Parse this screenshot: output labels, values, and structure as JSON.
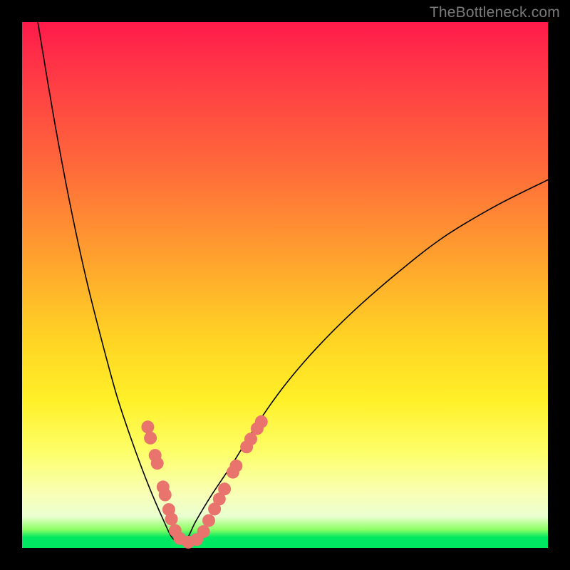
{
  "watermark": "TheBottleneck.com",
  "chart_data": {
    "type": "line",
    "title": "",
    "xlabel": "",
    "ylabel": "",
    "xlim": [
      0,
      100
    ],
    "ylim": [
      0,
      100
    ],
    "grid": false,
    "legend": false,
    "background_gradient": {
      "direction": "vertical",
      "note": "y_pct is distance from TOP of plot (0=top, 100=bottom); color encodes bottleneck severity, green=optimal",
      "stops": [
        {
          "y_pct": 0,
          "color": "#ff1a4a"
        },
        {
          "y_pct": 28,
          "color": "#ff6b3a"
        },
        {
          "y_pct": 60,
          "color": "#ffd324"
        },
        {
          "y_pct": 82,
          "color": "#fdff6b"
        },
        {
          "y_pct": 94,
          "color": "#eaffd0"
        },
        {
          "y_pct": 98,
          "color": "#00e861"
        }
      ]
    },
    "series": [
      {
        "name": "bottleneck-curve",
        "note": "V-shaped curve; x in arbitrary 0-100 units across plot width, y is percent from TOP (0=top edge). Minimum (~y=99) near x≈30.",
        "x": [
          3,
          6,
          9,
          12,
          15,
          18,
          21,
          24,
          27,
          28.5,
          30,
          31.5,
          33,
          36,
          40,
          45,
          50,
          56,
          63,
          71,
          80,
          90,
          100
        ],
        "y": [
          0,
          18,
          34,
          48,
          60,
          71,
          80,
          88,
          95,
          98,
          99,
          98,
          95,
          90,
          84,
          76,
          69,
          62,
          55,
          48,
          41,
          35,
          30
        ]
      }
    ],
    "markers": {
      "name": "highlighted-points",
      "note": "Pink dot clusters near the cusp on both branches (plot-fraction coords, 0-1 from top-left).",
      "points": [
        {
          "x": 0.239,
          "y": 0.77
        },
        {
          "x": 0.244,
          "y": 0.791
        },
        {
          "x": 0.253,
          "y": 0.824
        },
        {
          "x": 0.257,
          "y": 0.839
        },
        {
          "x": 0.268,
          "y": 0.884
        },
        {
          "x": 0.272,
          "y": 0.899
        },
        {
          "x": 0.279,
          "y": 0.927
        },
        {
          "x": 0.284,
          "y": 0.945
        },
        {
          "x": 0.291,
          "y": 0.967
        },
        {
          "x": 0.3,
          "y": 0.982
        },
        {
          "x": 0.316,
          "y": 0.989
        },
        {
          "x": 0.332,
          "y": 0.984
        },
        {
          "x": 0.345,
          "y": 0.969
        },
        {
          "x": 0.355,
          "y": 0.948
        },
        {
          "x": 0.366,
          "y": 0.926
        },
        {
          "x": 0.375,
          "y": 0.907
        },
        {
          "x": 0.385,
          "y": 0.888
        },
        {
          "x": 0.401,
          "y": 0.856
        },
        {
          "x": 0.407,
          "y": 0.844
        },
        {
          "x": 0.427,
          "y": 0.808
        },
        {
          "x": 0.435,
          "y": 0.793
        },
        {
          "x": 0.447,
          "y": 0.773
        },
        {
          "x": 0.455,
          "y": 0.76
        }
      ],
      "radius_px": 9
    }
  }
}
